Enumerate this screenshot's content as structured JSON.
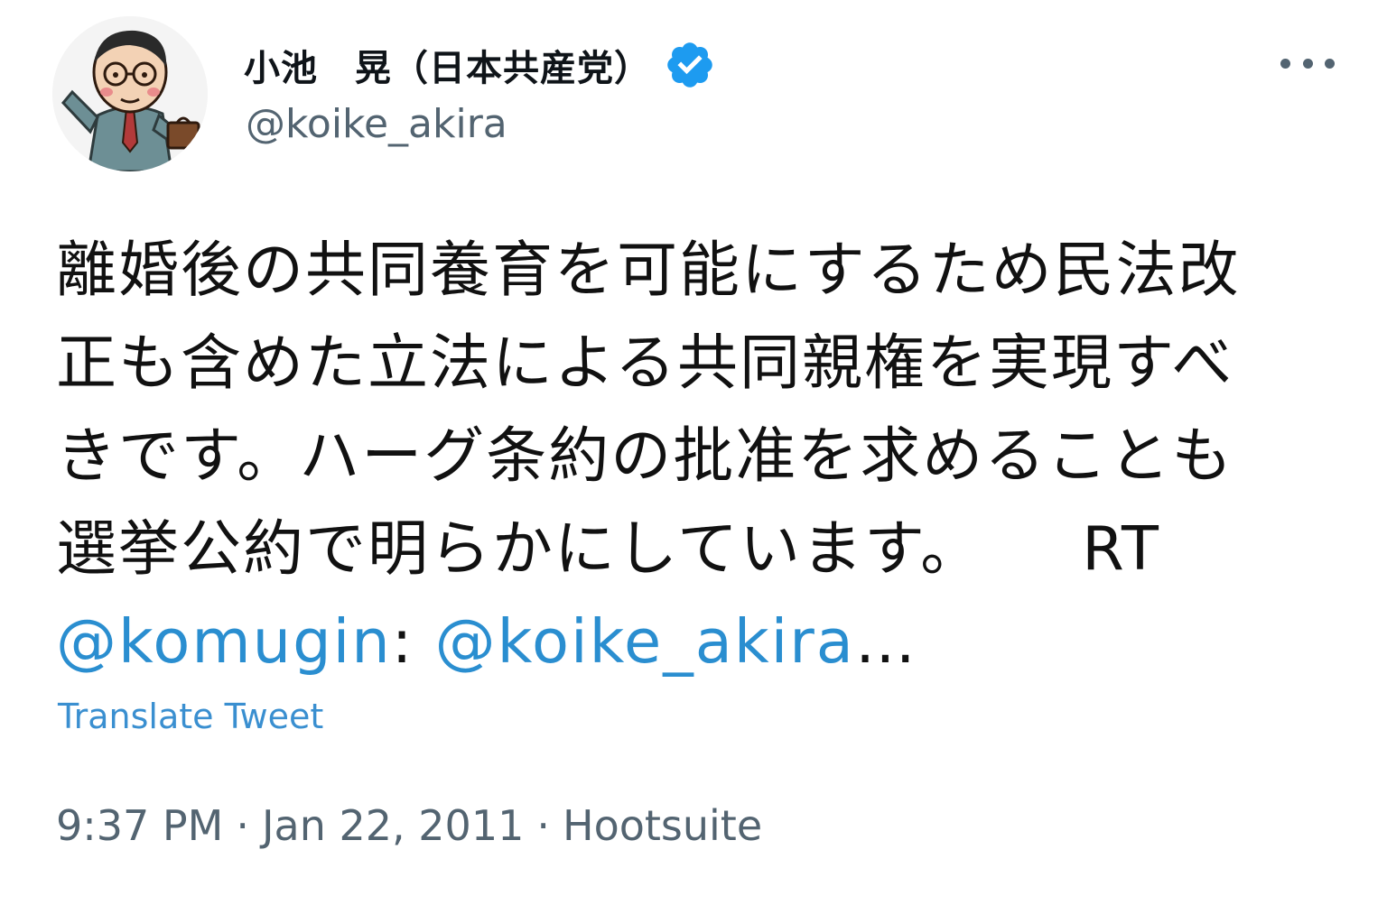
{
  "author": {
    "display_name": "小池　晃（日本共産党）",
    "handle": "@koike_akira",
    "verified": true,
    "avatar_icon": "cartoon-businessman-avatar"
  },
  "menu": {
    "more_icon": "more-horizontal-icon"
  },
  "tweet": {
    "lines": [
      "離婚後の共同養育を可能にするため民法改",
      "正も含めた立法による共同親権を実現すべ",
      "きです。ハーグ条約の批准を求めることも"
    ],
    "line4_text": "選挙公約で明らかにしています。",
    "rt_label": "RT",
    "mention_1": "@komugin",
    "mention_sep": ": ",
    "mention_2": "@koike_akira",
    "ellipsis": "…"
  },
  "translate_label": "Translate Tweet",
  "meta": {
    "time": "9:37 PM",
    "separator": "·",
    "date": "Jan 22, 2011",
    "source": "Hootsuite"
  },
  "colors": {
    "link": "#2a8ed0",
    "verified": "#1d9bf0",
    "secondary_text": "#536471"
  }
}
